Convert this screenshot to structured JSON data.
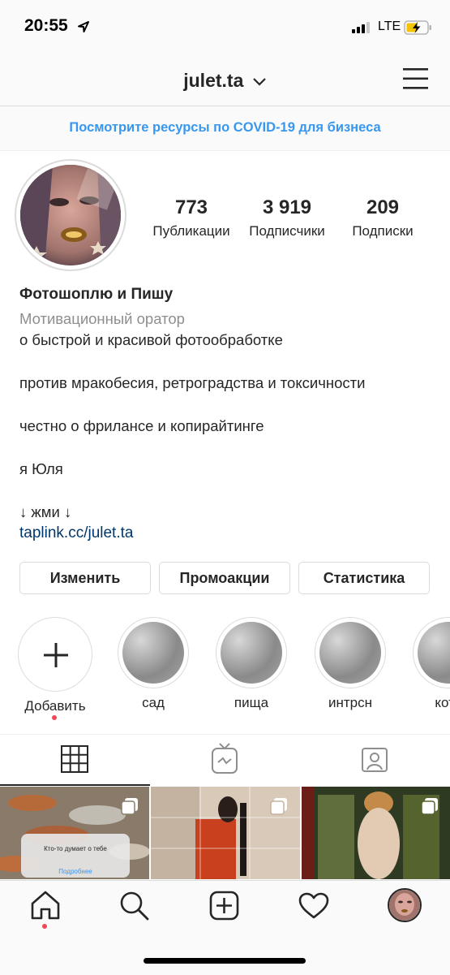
{
  "status_bar": {
    "time": "20:55",
    "network": "LTE"
  },
  "header": {
    "username": "julet.ta"
  },
  "covid_banner": {
    "text": "Посмотрите ресурсы по COVID-19 для бизнеса"
  },
  "profile": {
    "stats": [
      {
        "value": "773",
        "label": "Публикации"
      },
      {
        "value": "3 919",
        "label": "Подписчики"
      },
      {
        "value": "209",
        "label": "Подписки"
      }
    ],
    "name": "Фотошоплю и Пишу",
    "category": "Мотивационный оратор",
    "bio_lines": [
      "о быстрой и красивой фотообработке",
      "против мракобесия, ретроградства и токсичности",
      "честно о фрилансе и копирайтинге",
      "я Юля",
      "↓ жми ↓"
    ],
    "link": "taplink.cc/julet.ta"
  },
  "actions": {
    "edit": "Изменить",
    "promotions": "Промоакции",
    "statistics": "Статистика"
  },
  "highlights": {
    "add_label": "Добавить",
    "items": [
      "сад",
      "пища",
      "интрсн",
      "котэ"
    ]
  },
  "grid_post": {
    "text": "Кто-то думает о тебе",
    "more": "Подробнее"
  },
  "colors": {
    "accent": "#3897f0",
    "link": "#00376b",
    "notification": "#ed4956"
  }
}
